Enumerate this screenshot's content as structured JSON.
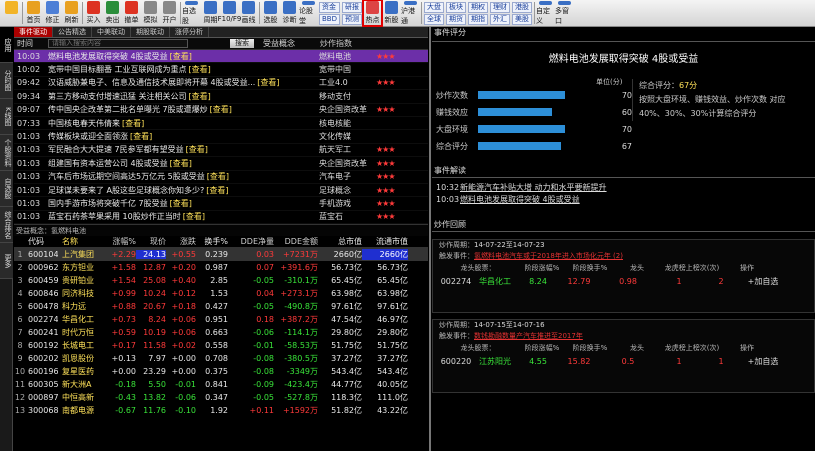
{
  "toolbar": {
    "buttons": [
      {
        "label": "",
        "icon": "back-arrow-icon",
        "color": "#f2b428"
      },
      {
        "label": "首页",
        "icon": "star-icon",
        "color": "#e8a020"
      },
      {
        "label": "修正",
        "icon": "cycle-icon",
        "color": "#4d7fd6"
      },
      {
        "label": "刷新",
        "icon": "refresh-icon",
        "color": "#e8a020"
      },
      {
        "label": "买入",
        "icon": "buy-icon",
        "color": "#d32"
      },
      {
        "label": "卖出",
        "icon": "sell-icon",
        "color": "#2b8e3b"
      },
      {
        "label": "撤单",
        "icon": "cancel-order-icon",
        "color": "#d32"
      },
      {
        "label": "模拟",
        "icon": "simulate-icon",
        "color": "#888"
      },
      {
        "label": "开户",
        "icon": "open-account-icon",
        "color": "#888"
      },
      {
        "label": "自选股",
        "icon": "grid-icon",
        "color": "#3a6fc4"
      },
      {
        "label": "周期",
        "icon": "clock-icon",
        "color": "#3a6fc4"
      },
      {
        "label": "F10/F9",
        "icon": "f10-icon",
        "color": "#3a6fc4"
      },
      {
        "label": "画线",
        "icon": "draw-line-icon",
        "color": "#3a6fc4"
      },
      {
        "label": "选股",
        "icon": "filter-icon",
        "color": "#3a6fc4"
      },
      {
        "label": "诊断",
        "icon": "diagnose-icon",
        "color": "#3a6fc4"
      },
      {
        "label": "论股堂",
        "icon": "chat-icon",
        "color": "#3a6fc4"
      }
    ],
    "group_a": [
      "资金",
      "BBD"
    ],
    "group_b": [
      "研报",
      "预测"
    ],
    "hot": {
      "label": "热点",
      "icon": "hot-topic-icon"
    },
    "buttons2": [
      {
        "label": "新股",
        "icon": "new-stock-icon",
        "color": "#3a6fc4"
      },
      {
        "label": "沪港通",
        "icon": "hk-connect-icon",
        "color": "#3a6fc4"
      }
    ],
    "group_c": [
      "大盘",
      "全球"
    ],
    "group_d": [
      "板块",
      "期货"
    ],
    "group_e": [
      "期权",
      "期指"
    ],
    "group_f": [
      "理财",
      "外汇"
    ],
    "group_g": [
      "港股",
      "美股"
    ],
    "buttons3": [
      {
        "label": "自定义",
        "icon": "custom-icon",
        "color": "#3a6fc4"
      },
      {
        "label": "多窗口",
        "icon": "multi-window-icon",
        "color": "#3a6fc4"
      }
    ]
  },
  "sidebar": [
    "应用",
    "分时图",
    "K线图",
    "个股资料",
    "自选股",
    "综合排名",
    "更多"
  ],
  "tabs": [
    "事件驱动",
    "公告精选",
    "中美联动",
    "期股联动",
    "涨停分析"
  ],
  "news_header": {
    "time": "时间",
    "search_placeholder": "请输入搜索内容",
    "search_button": "搜索",
    "concept": "受益概念",
    "index": "炒作指数"
  },
  "news": [
    {
      "time": "10:03",
      "title": "燃料电池发展取得突破 4股或受益",
      "view": "[查看]",
      "concept": "燃料电池",
      "stars": "★★★"
    },
    {
      "time": "10:02",
      "title": "宽带中国目标翻番 工业互联网成为重点",
      "view": "[查看]",
      "concept": "宽带中国",
      "stars": ""
    },
    {
      "time": "09:42",
      "title": "汉语威胁兼电子、信息及通信技术展即将开幕 4股或受益...",
      "view": "[查看]",
      "concept": "工业4.0",
      "stars": "★★★"
    },
    {
      "time": "09:34",
      "title": "第三方移动支付增速迅猛 关注相关公司",
      "view": "[查看]",
      "concept": "移动支付",
      "stars": ""
    },
    {
      "time": "09:07",
      "title": "传中国央企改革第二批名单曝光 7股或遭爆炒",
      "view": "[查看]",
      "concept": "央企国资改革",
      "stars": "★★★"
    },
    {
      "time": "07:33",
      "title": "中国核电春天伟倩来",
      "view": "[查看]",
      "concept": "核电核能",
      "stars": ""
    },
    {
      "time": "01:03",
      "title": "传媒板块或迎全面领涨",
      "view": "[查看]",
      "concept": "文化传媒",
      "stars": ""
    },
    {
      "time": "01:03",
      "title": "军民融合大大提速 7民参军都有望受益",
      "view": "[查看]",
      "concept": "航天军工",
      "stars": "★★★"
    },
    {
      "time": "01:03",
      "title": "组建国有资本运营公司 4股或受益",
      "view": "[查看]",
      "concept": "央企国资改革",
      "stars": "★★★"
    },
    {
      "time": "01:03",
      "title": "汽车后市场远期空间高达5万亿元 5股或受益",
      "view": "[查看]",
      "concept": "汽车电子",
      "stars": "★★★"
    },
    {
      "time": "01:03",
      "title": "足球谋未要来了 A股这些足球概念你知多少?",
      "view": "[查看]",
      "concept": "足球概念",
      "stars": "★★★"
    },
    {
      "time": "01:03",
      "title": "国内手游市场将突破千亿 7股受益",
      "view": "[查看]",
      "concept": "手机游戏",
      "stars": "★★★"
    },
    {
      "time": "01:03",
      "title": "蓝宝石药茶苹果采用 10股炒作正当时",
      "view": "[查看]",
      "concept": "蓝宝石",
      "stars": "★★★"
    }
  ],
  "concept_title": "受益概念：氢燃料电池",
  "stock_header": [
    "",
    "代码",
    "名称",
    "涨幅%",
    "现价",
    "涨跌",
    "换手%",
    "DDE净量",
    "DDE金额",
    "总市值",
    "流通市值"
  ],
  "stocks": [
    {
      "n": "1",
      "code": "600104",
      "name": "上汽集团",
      "pct": "+2.29",
      "price": "24.13",
      "chg": "+0.55",
      "turn": "0.239",
      "dde": "0.03",
      "amt": "+7231万",
      "cap": "2660亿",
      "fcap": "2660亿",
      "pc": "red",
      "dc": "red",
      "ac": "red"
    },
    {
      "n": "2",
      "code": "000962",
      "name": "东方钽业",
      "pct": "+1.58",
      "price": "12.87",
      "chg": "+0.20",
      "turn": "0.987",
      "dde": "0.07",
      "amt": "+391.6万",
      "cap": "56.73亿",
      "fcap": "56.73亿",
      "pc": "red",
      "dc": "red",
      "ac": "red"
    },
    {
      "n": "3",
      "code": "600459",
      "name": "贵研铂业",
      "pct": "+1.54",
      "price": "25.08",
      "chg": "+0.40",
      "turn": "2.85",
      "dde": "-0.05",
      "amt": "-310.1万",
      "cap": "65.45亿",
      "fcap": "65.45亿",
      "pc": "red",
      "dc": "green",
      "ac": "green"
    },
    {
      "n": "4",
      "code": "600846",
      "name": "同济科技",
      "pct": "+0.99",
      "price": "10.24",
      "chg": "+0.12",
      "turn": "1.53",
      "dde": "0.04",
      "amt": "+273.1万",
      "cap": "63.98亿",
      "fcap": "63.98亿",
      "pc": "red",
      "dc": "red",
      "ac": "red"
    },
    {
      "n": "5",
      "code": "600478",
      "name": "科力远",
      "pct": "+0.88",
      "price": "20.67",
      "chg": "+0.18",
      "turn": "0.427",
      "dde": "-0.05",
      "amt": "-490.8万",
      "cap": "97.61亿",
      "fcap": "97.61亿",
      "pc": "red",
      "dc": "green",
      "ac": "green"
    },
    {
      "n": "6",
      "code": "002274",
      "name": "华昌化工",
      "pct": "+0.73",
      "price": "8.24",
      "chg": "+0.06",
      "turn": "0.951",
      "dde": "0.18",
      "amt": "+387.2万",
      "cap": "47.54亿",
      "fcap": "46.97亿",
      "pc": "red",
      "dc": "red",
      "ac": "red"
    },
    {
      "n": "7",
      "code": "600241",
      "name": "时代万恒",
      "pct": "+0.59",
      "price": "10.19",
      "chg": "+0.06",
      "turn": "0.663",
      "dde": "-0.06",
      "amt": "-114.1万",
      "cap": "29.80亿",
      "fcap": "29.80亿",
      "pc": "red",
      "dc": "green",
      "ac": "green"
    },
    {
      "n": "8",
      "code": "600192",
      "name": "长城电工",
      "pct": "+0.17",
      "price": "11.58",
      "chg": "+0.02",
      "turn": "0.558",
      "dde": "-0.01",
      "amt": "-58.53万",
      "cap": "51.75亿",
      "fcap": "51.75亿",
      "pc": "red",
      "dc": "green",
      "ac": "green"
    },
    {
      "n": "9",
      "code": "600202",
      "name": "凯恩股份",
      "pct": "+0.13",
      "price": "7.97",
      "chg": "+0.00",
      "turn": "0.708",
      "dde": "-0.08",
      "amt": "-380.5万",
      "cap": "37.27亿",
      "fcap": "37.27亿",
      "pc": "white",
      "dc": "green",
      "ac": "green"
    },
    {
      "n": "10",
      "code": "600196",
      "name": "复星医药",
      "pct": "+0.00",
      "price": "23.29",
      "chg": "+0.00",
      "turn": "0.375",
      "dde": "-0.08",
      "amt": "-3349万",
      "cap": "543.4亿",
      "fcap": "543.4亿",
      "pc": "white",
      "dc": "green",
      "ac": "green"
    },
    {
      "n": "11",
      "code": "600305",
      "name": "新大洲A",
      "pct": "-0.18",
      "price": "5.50",
      "chg": "-0.01",
      "turn": "0.841",
      "dde": "-0.09",
      "amt": "-423.4万",
      "cap": "44.77亿",
      "fcap": "40.05亿",
      "pc": "green",
      "dc": "green",
      "ac": "green"
    },
    {
      "n": "12",
      "code": "000897",
      "name": "中恒高新",
      "pct": "-0.43",
      "price": "13.82",
      "chg": "-0.06",
      "turn": "0.347",
      "dde": "-0.05",
      "amt": "-527.8万",
      "cap": "118.3亿",
      "fcap": "111.0亿",
      "pc": "green",
      "dc": "green",
      "ac": "green"
    },
    {
      "n": "13",
      "code": "300068",
      "name": "南都电源",
      "pct": "-0.67",
      "price": "11.76",
      "chg": "-0.10",
      "turn": "1.92",
      "dde": "+0.11",
      "amt": "+1592万",
      "cap": "51.82亿",
      "fcap": "43.22亿",
      "pc": "green",
      "dc": "red",
      "ac": "red"
    }
  ],
  "event_score": {
    "section_title": "事件评分",
    "title": "燃料电池发展取得突破 4股或受益",
    "unit_label": "单位(分)",
    "bars": [
      {
        "label": "炒作次数",
        "value": 70
      },
      {
        "label": "赚钱效应",
        "value": 60
      },
      {
        "label": "大盘环境",
        "value": 70
      },
      {
        "label": "综合评分",
        "value": 67
      }
    ],
    "summary_label": "综合评分：",
    "summary_score": "67分",
    "summary_text1": "按照大盘环境、赚钱效益、炒作次数 对应",
    "summary_text2": "40%、30%、30%计算综合评分"
  },
  "event_explain": {
    "section_title": "事件解读",
    "items": [
      {
        "time": "10:32",
        "text": "新能源汽车补贴大增 动力和水平要新提升"
      },
      {
        "time": "10:03",
        "text": "燃料电池发展取得突破 4股或受益"
      }
    ]
  },
  "hype_review": {
    "section_title": "炒作回顾",
    "col_headers": [
      "龙头股票：",
      "阶段涨幅%",
      "阶段换手%",
      "龙头",
      "龙虎榜上榜次(次)",
      "操作"
    ],
    "blocks": [
      {
        "period_label": "炒作周期：",
        "period": "14-07-22至14-07-23",
        "trigger_label": "触发事件：",
        "trigger": "氢燃料电池汽车或于2018年进入市场化元年 (2)",
        "code": "002274",
        "name": "华昌化工",
        "price": "8.24",
        "gain": "12.79",
        "turn": "0.98",
        "leader": "1",
        "times": "2",
        "action": "+加自选"
      },
      {
        "period_label": "炒作周期：",
        "period": "14-07-15至14-07-16",
        "trigger_label": "触发事件：",
        "trigger": "数钱勘融数量产汽车推进至2017年",
        "code": "600220",
        "name": "江苏阳光",
        "price": "4.55",
        "gain": "15.82",
        "turn": "0.5",
        "leader": "1",
        "times": "1",
        "action": "+加自选"
      }
    ]
  }
}
